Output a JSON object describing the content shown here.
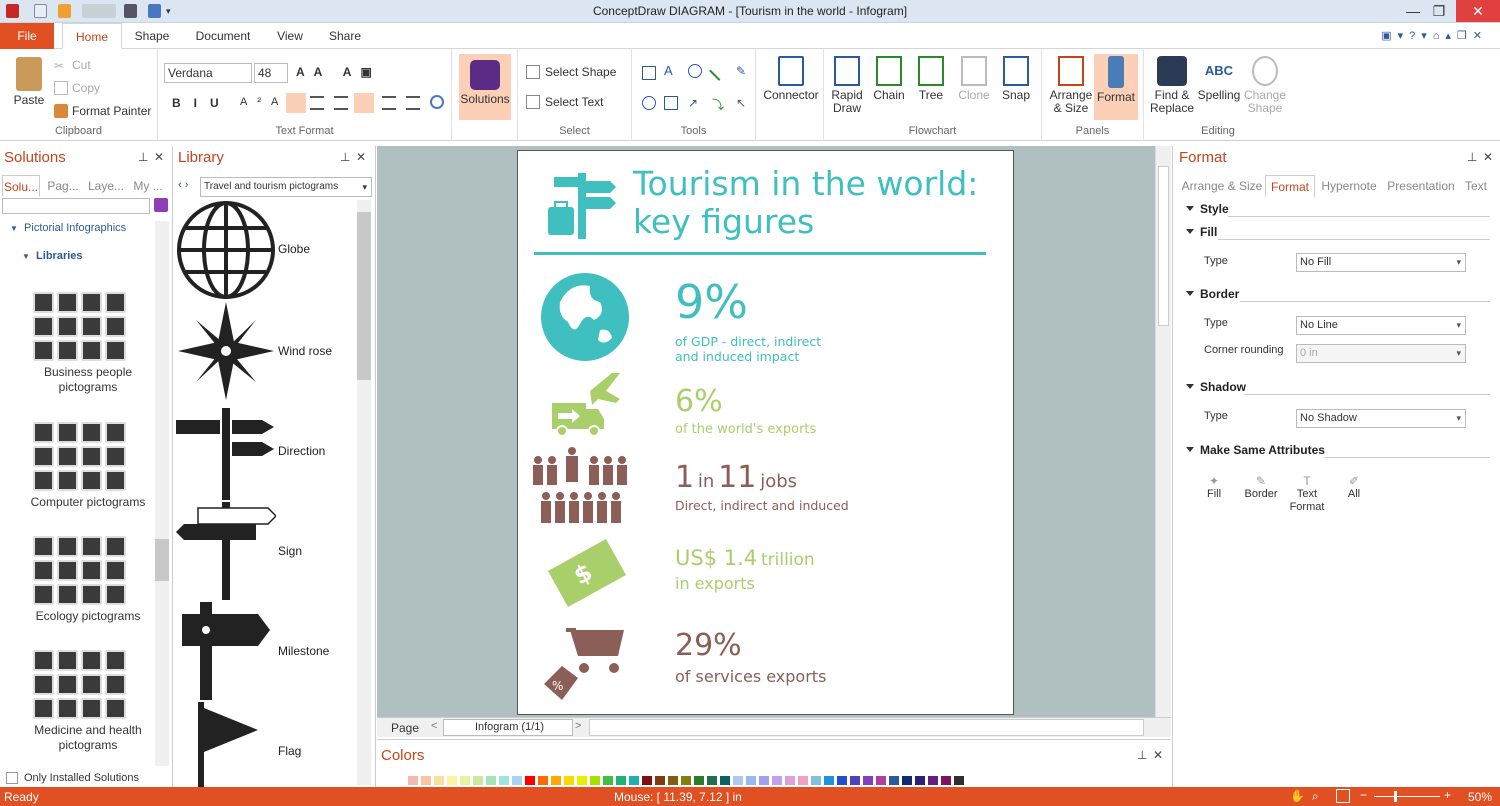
{
  "window": {
    "title": "ConceptDraw DIAGRAM - [Tourism in the world - Infogram]"
  },
  "tabs": {
    "file": "File",
    "home": "Home",
    "shape": "Shape",
    "document": "Document",
    "view": "View",
    "share": "Share"
  },
  "clipboard": {
    "paste": "Paste",
    "cut": "Cut",
    "copy": "Copy",
    "format_painter": "Format Painter",
    "label": "Clipboard"
  },
  "text_format": {
    "font": "Verdana",
    "size": "48",
    "label": "Text Format"
  },
  "solutions_btn": "Solutions",
  "select": {
    "select_shape": "Select Shape",
    "select_text": "Select Text",
    "label": "Select"
  },
  "tools_label": "Tools",
  "connector": "Connector",
  "flowchart": {
    "rapid_draw": "Rapid Draw",
    "chain": "Chain",
    "tree": "Tree",
    "clone": "Clone",
    "snap": "Snap",
    "label": "Flowchart"
  },
  "panels": {
    "arrange": "Arrange & Size",
    "format": "Format",
    "label": "Panels"
  },
  "editing": {
    "find": "Find & Replace",
    "spelling": "Spelling",
    "change_shape": "Change Shape",
    "label": "Editing"
  },
  "solutions_panel": {
    "title": "Solutions",
    "tabs": [
      "Solu...",
      "Pag...",
      "Laye...",
      "My ..."
    ],
    "tree_root": "Pictorial Infographics",
    "tree_child": "Libraries",
    "items": [
      "Business people pictograms",
      "Computer pictograms",
      "Ecology pictograms",
      "Medicine and health pictograms"
    ],
    "only_installed": "Only Installed Solutions"
  },
  "library_panel": {
    "title": "Library",
    "selected": "Travel and tourism pictograms",
    "items": [
      "Globe",
      "Wind rose",
      "Direction",
      "Sign",
      "Milestone",
      "Flag"
    ]
  },
  "infographic": {
    "title_line1": "Tourism in the world:",
    "title_line2": "key figures",
    "s1_big": "9%",
    "s1_l1": "of GDP - direct, indirect",
    "s1_l2": "and induced impact",
    "s2_big": "6%",
    "s2_l1": "of the world's exports",
    "s3_big1": "1",
    "s3_in": "in",
    "s3_big2": "11",
    "s3_jobs": "jobs",
    "s3_l1": "Direct, indirect and induced",
    "s4_big": "US$ 1.4",
    "s4_tr": "trillion",
    "s4_l1": "in exports",
    "s5_big": "29%",
    "s5_l1": "of services exports",
    "colors": {
      "teal": "#3fbfbf",
      "green": "#a9cf6b",
      "brown": "#8b5e57"
    }
  },
  "page_nav": {
    "page": "Page",
    "current": "Infogram (1/1)"
  },
  "colors_panel": {
    "title": "Colors"
  },
  "format_panel": {
    "title": "Format",
    "tabs": [
      "Arrange & Size",
      "Format",
      "Hypernote",
      "Presentation",
      "Text"
    ],
    "style": "Style",
    "fill": "Fill",
    "border": "Border",
    "shadow": "Shadow",
    "make_same": "Make Same Attributes",
    "type": "Type",
    "corner": "Corner rounding",
    "fill_type": "No Fill",
    "border_type": "No Line",
    "corner_val": "0 in",
    "shadow_type": "No Shadow",
    "ms_fill": "Fill",
    "ms_border": "Border",
    "ms_text": "Text Format",
    "ms_all": "All"
  },
  "status": {
    "left": "Ready",
    "mouse": "Mouse: [ 11.39, 7.12 ] in",
    "zoom": "50%"
  }
}
